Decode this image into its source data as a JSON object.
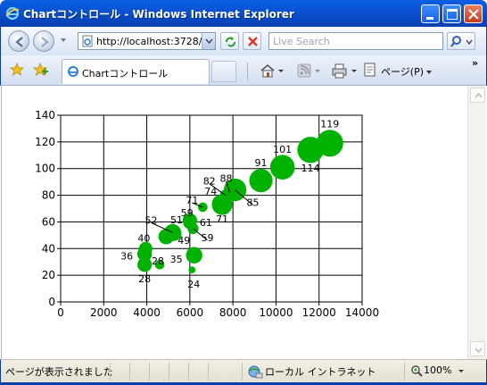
{
  "window": {
    "title": "Chartコントロール - Windows Internet Explorer"
  },
  "address_bar": {
    "url": "http://localhost:3728/",
    "search_placeholder": "Live Search"
  },
  "tab": {
    "label": "Chartコントロール"
  },
  "commands": {
    "page_label": "ページ(P)"
  },
  "status": {
    "text": "ページが表示されました",
    "zone": "ローカル イントラネット",
    "zoom": "100%"
  },
  "colors": {
    "bubble": "#00b200",
    "titlebar": "#0a52d2"
  },
  "chart_data": {
    "type": "scatter",
    "subtype": "bubble",
    "xlim": [
      0,
      14000
    ],
    "ylim": [
      0,
      140
    ],
    "x_ticks": [
      0,
      2000,
      4000,
      6000,
      8000,
      10000,
      12000,
      14000
    ],
    "y_ticks": [
      0,
      20,
      40,
      60,
      80,
      100,
      120,
      140
    ],
    "grid": true,
    "points": [
      {
        "x": 12500,
        "y": 119,
        "size": 119,
        "label": "119"
      },
      {
        "x": 11600,
        "y": 114,
        "size": 114,
        "label": "114"
      },
      {
        "x": 10300,
        "y": 101,
        "size": 101,
        "label": "101"
      },
      {
        "x": 9300,
        "y": 91,
        "size": 91,
        "label": "91"
      },
      {
        "x": 8100,
        "y": 84,
        "size": 85,
        "label": "85"
      },
      {
        "x": 7850,
        "y": 82,
        "size": 20,
        "label": "88"
      },
      {
        "x": 7650,
        "y": 80,
        "size": 20,
        "label": "82"
      },
      {
        "x": 7500,
        "y": 73,
        "size": 71,
        "label": "71"
      },
      {
        "x": 7300,
        "y": 75,
        "size": 20,
        "label": "74"
      },
      {
        "x": 6600,
        "y": 71,
        "size": 15,
        "label": "71"
      },
      {
        "x": 6000,
        "y": 61,
        "size": 35,
        "label": "61"
      },
      {
        "x": 5950,
        "y": 59,
        "size": 20,
        "label": "59"
      },
      {
        "x": 6150,
        "y": 55,
        "size": 20,
        "label": "59"
      },
      {
        "x": 5200,
        "y": 52,
        "size": 48,
        "label": "52"
      },
      {
        "x": 5300,
        "y": 51,
        "size": 30,
        "label": "51"
      },
      {
        "x": 4900,
        "y": 49,
        "size": 40,
        "label": "49"
      },
      {
        "x": 3950,
        "y": 40,
        "size": 30,
        "label": "40"
      },
      {
        "x": 3900,
        "y": 36,
        "size": 36,
        "label": "36"
      },
      {
        "x": 6200,
        "y": 35,
        "size": 45,
        "label": "35"
      },
      {
        "x": 4600,
        "y": 28,
        "size": 15,
        "label": "28"
      },
      {
        "x": 3900,
        "y": 28,
        "size": 35,
        "label": "28"
      },
      {
        "x": 6100,
        "y": 24,
        "size": 8,
        "label": "24"
      }
    ]
  }
}
